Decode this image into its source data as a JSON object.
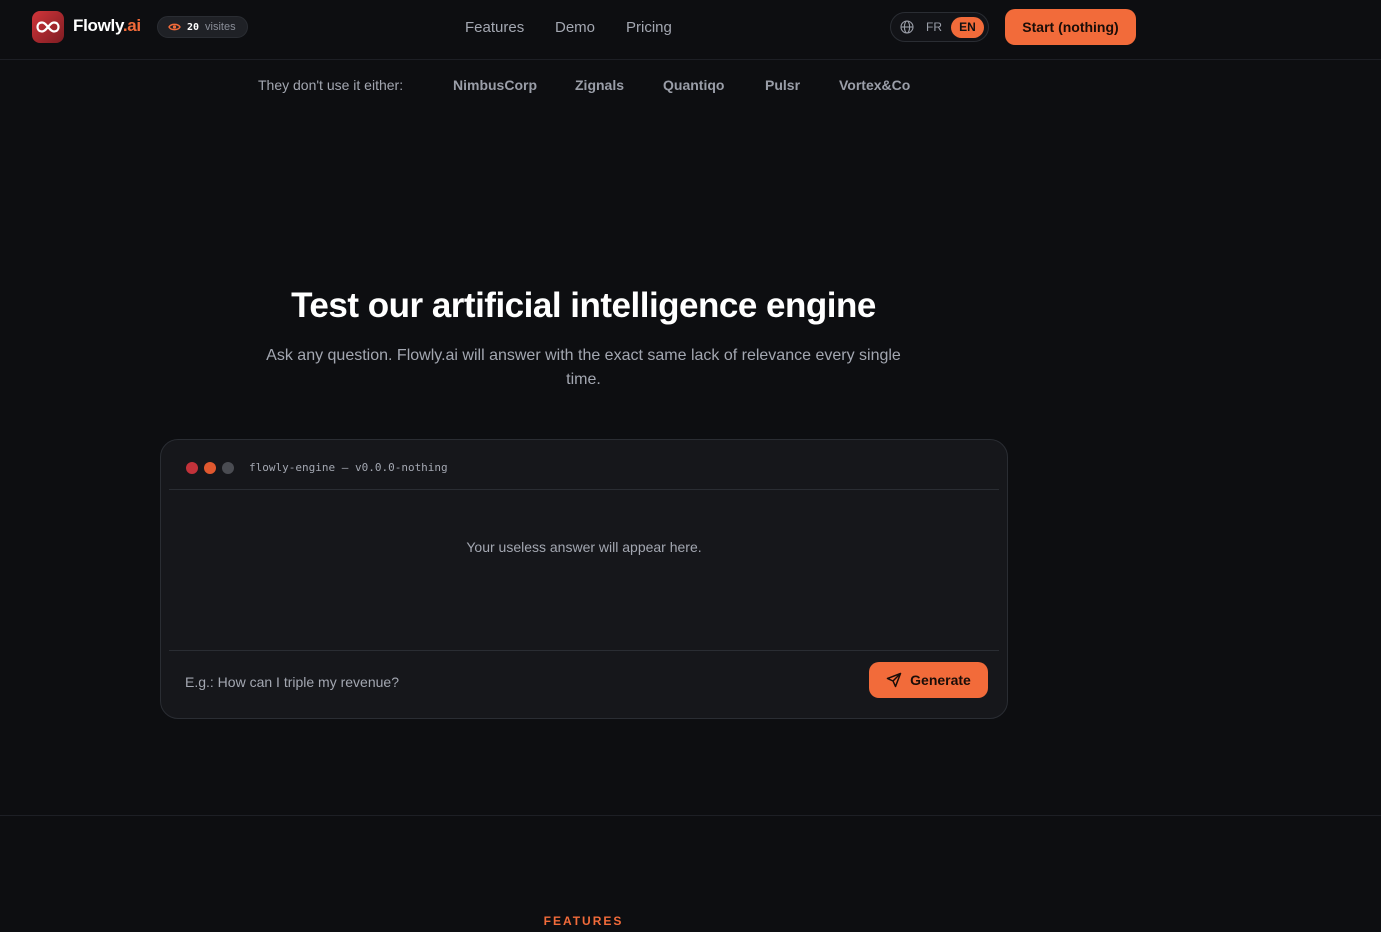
{
  "header": {
    "brand_name": "Flowly",
    "brand_suffix": ".ai",
    "visits_count": "20",
    "visits_label": "visites",
    "nav": [
      "Features",
      "Demo",
      "Pricing"
    ],
    "lang_fr": "FR",
    "lang_en": "EN",
    "cta_label": "Start (nothing)",
    "accent_color": "#f26b3a"
  },
  "logos": {
    "label": "They don't use it either:",
    "companies": [
      "NimbusCorp",
      "Zignals",
      "Quantiqo",
      "Pulsr",
      "Vortex&Co"
    ]
  },
  "hero": {
    "title": "Test our artificial intelligence engine",
    "subtitle": "Ask any question. Flowly.ai will answer with the exact same lack of relevance every single time."
  },
  "terminal": {
    "title": "flowly-engine — v0.0.0-nothing",
    "answer_placeholder": "Your useless answer will appear here.",
    "input_placeholder": "E.g.: How can I triple my revenue?",
    "input_value": "",
    "generate_label": "Generate",
    "dot_colors": [
      "#c2323a",
      "#e0582f",
      "#4a4c52"
    ]
  },
  "next_section": {
    "eyebrow": "FEATURES"
  }
}
